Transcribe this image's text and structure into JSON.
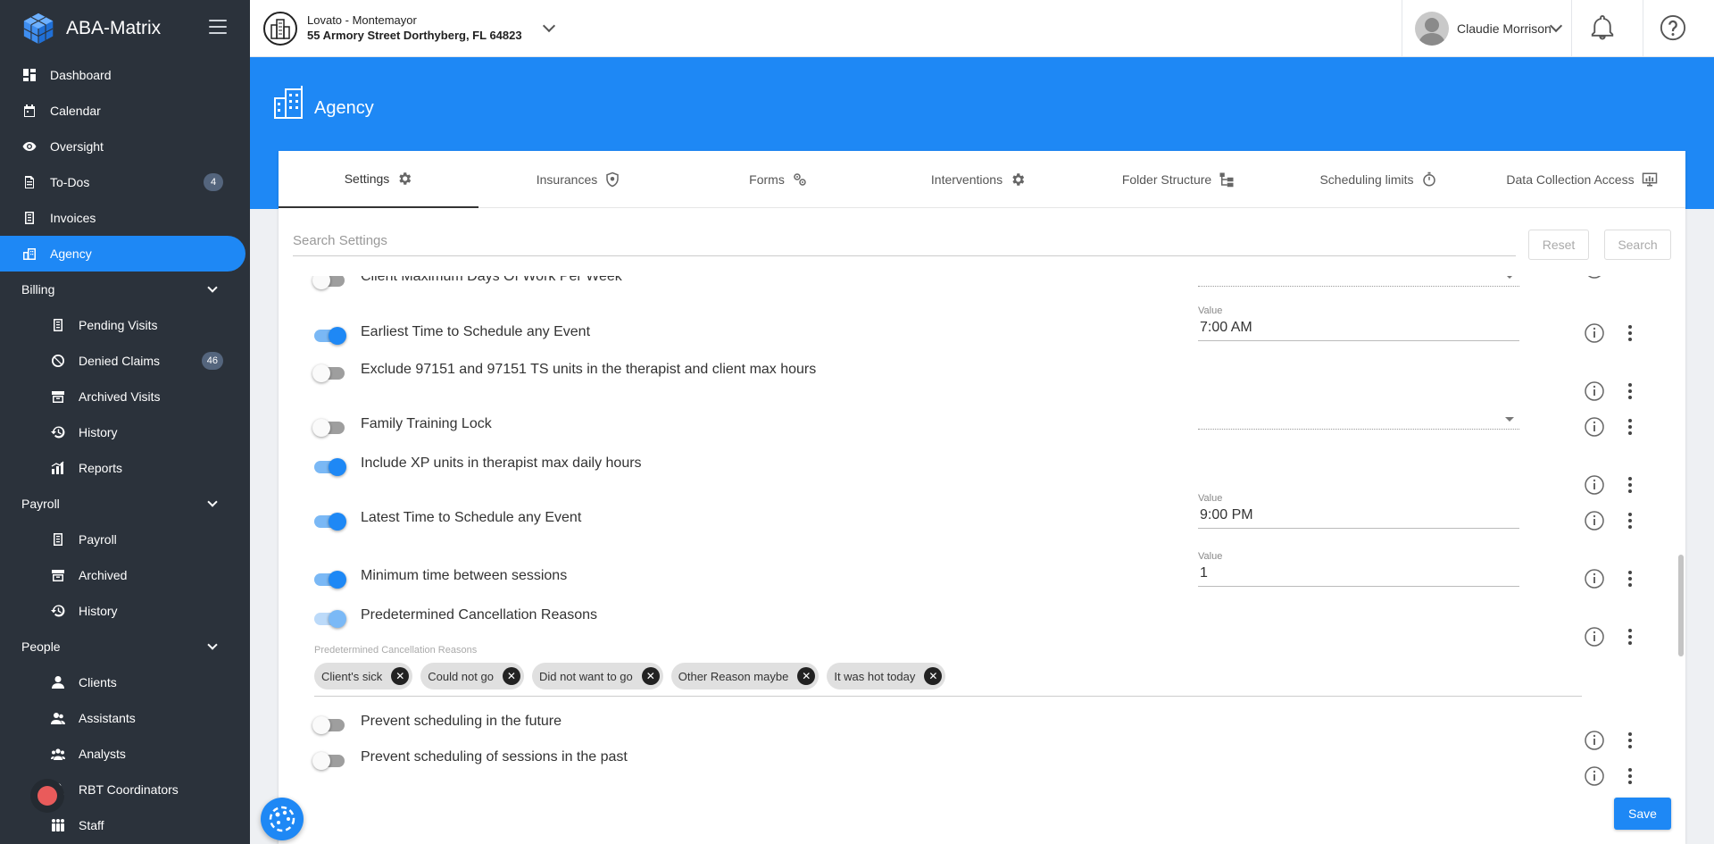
{
  "app": {
    "name": "ABA-Matrix"
  },
  "organization": {
    "name": "Lovato - Montemayor",
    "address": "55 Armory Street Dorthyberg, FL 64823"
  },
  "user": {
    "name": "Claudie Morrison"
  },
  "page": {
    "title": "Agency"
  },
  "sidebar": {
    "items": [
      {
        "label": "Dashboard",
        "icon": "dashboard-icon"
      },
      {
        "label": "Calendar",
        "icon": "calendar-icon"
      },
      {
        "label": "Oversight",
        "icon": "eye-icon"
      },
      {
        "label": "To-Dos",
        "icon": "todo-icon",
        "badge": "4"
      },
      {
        "label": "Invoices",
        "icon": "invoice-icon"
      },
      {
        "label": "Agency",
        "icon": "building-icon",
        "active": true
      }
    ],
    "billing": {
      "label": "Billing",
      "items": [
        {
          "label": "Pending Visits"
        },
        {
          "label": "Denied Claims",
          "badge": "46"
        },
        {
          "label": "Archived Visits"
        },
        {
          "label": "History"
        },
        {
          "label": "Reports"
        }
      ]
    },
    "payroll": {
      "label": "Payroll",
      "items": [
        {
          "label": "Payroll"
        },
        {
          "label": "Archived"
        },
        {
          "label": "History"
        }
      ]
    },
    "people": {
      "label": "People",
      "items": [
        {
          "label": "Clients"
        },
        {
          "label": "Assistants"
        },
        {
          "label": "Analysts"
        },
        {
          "label": "RBT Coordinators"
        },
        {
          "label": "Staff"
        }
      ]
    }
  },
  "tabs": [
    {
      "label": "Settings",
      "icon": "gear-icon",
      "active": true
    },
    {
      "label": "Insurances",
      "icon": "shield-icon"
    },
    {
      "label": "Forms",
      "icon": "gears-icon"
    },
    {
      "label": "Interventions",
      "icon": "gear-icon"
    },
    {
      "label": "Folder Structure",
      "icon": "folder-tree-icon"
    },
    {
      "label": "Scheduling limits",
      "icon": "stopwatch-icon"
    },
    {
      "label": "Data Collection Access",
      "icon": "monitor-chart-icon"
    }
  ],
  "search": {
    "placeholder": "Search Settings",
    "reset_label": "Reset",
    "search_label": "Search"
  },
  "settings": [
    {
      "label": "Client Maximum Days Of Work Per Week",
      "enabled": false
    },
    {
      "label": "Earliest Time to Schedule any Event",
      "enabled": true,
      "value_label": "Value",
      "value": "7:00 AM"
    },
    {
      "label": "Exclude 97151 and 97151 TS units in the therapist and client max hours",
      "enabled": false
    },
    {
      "label": "Family Training Lock",
      "enabled": false
    },
    {
      "label": "Include XP units in therapist max daily hours",
      "enabled": true
    },
    {
      "label": "Latest Time to Schedule any Event",
      "enabled": true,
      "value_label": "Value",
      "value": "9:00 PM"
    },
    {
      "label": "Minimum time between sessions",
      "enabled": true,
      "value_label": "Value",
      "value": "1"
    },
    {
      "label": "Predetermined Cancellation Reasons",
      "enabled": true
    },
    {
      "label": "Prevent scheduling in the future",
      "enabled": false
    },
    {
      "label": "Prevent scheduling of sessions in the past",
      "enabled": false
    }
  ],
  "cancellation": {
    "field_label": "Predetermined Cancellation Reasons",
    "chips": [
      "Client's sick",
      "Could not go",
      "Did not want to go",
      "Other Reason maybe",
      "It was hot today"
    ]
  },
  "save_label": "Save"
}
